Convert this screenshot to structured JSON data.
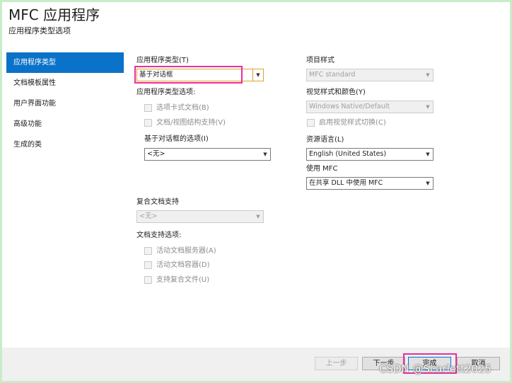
{
  "header": {
    "title": "MFC 应用程序",
    "subtitle": "应用程序类型选项"
  },
  "nav": {
    "items": [
      {
        "label": "应用程序类型",
        "active": true
      },
      {
        "label": "文档模板属性",
        "active": false
      },
      {
        "label": "用户界面功能",
        "active": false
      },
      {
        "label": "高级功能",
        "active": false
      },
      {
        "label": "生成的类",
        "active": false
      }
    ]
  },
  "left": {
    "app_type_label": "应用程序类型(T)",
    "app_type_value": "基于对话框",
    "app_type_options_label": "应用程序类型选项:",
    "tabbed_docs_label": "选项卡式文档(B)",
    "docview_label": "文档/视图结构支持(V)",
    "dialog_options_label": "基于对话框的选项(I)",
    "dialog_options_value": "<无>",
    "compound_label": "复合文档支持",
    "compound_value": "<无>",
    "doc_support_label": "文档支持选项:",
    "active_server_label": "活动文档服务器(A)",
    "active_container_label": "活动文档容器(D)",
    "compound_file_label": "支持复合文件(U)"
  },
  "right": {
    "project_style_label": "项目样式",
    "project_style_value": "MFC standard",
    "visual_style_label": "视觉样式和颜色(Y)",
    "visual_style_value": "Windows Native/Default",
    "visual_toggle_label": "启用视觉样式切换(C)",
    "resource_lang_label": "资源语言(L)",
    "resource_lang_value": "English (United States)",
    "use_mfc_label": "使用 MFC",
    "use_mfc_value": "在共享 DLL 中使用 MFC"
  },
  "footer": {
    "prev": "上一步",
    "next": "下一步",
    "finish": "完成",
    "cancel": "取消"
  },
  "watermark": "CSDN @Scarlett2025",
  "colors": {
    "accent": "#0a72c8",
    "highlight": "#e8309a",
    "frame": "#c9ebc9"
  },
  "icons": {
    "dropdown": "chevron-down-icon"
  }
}
